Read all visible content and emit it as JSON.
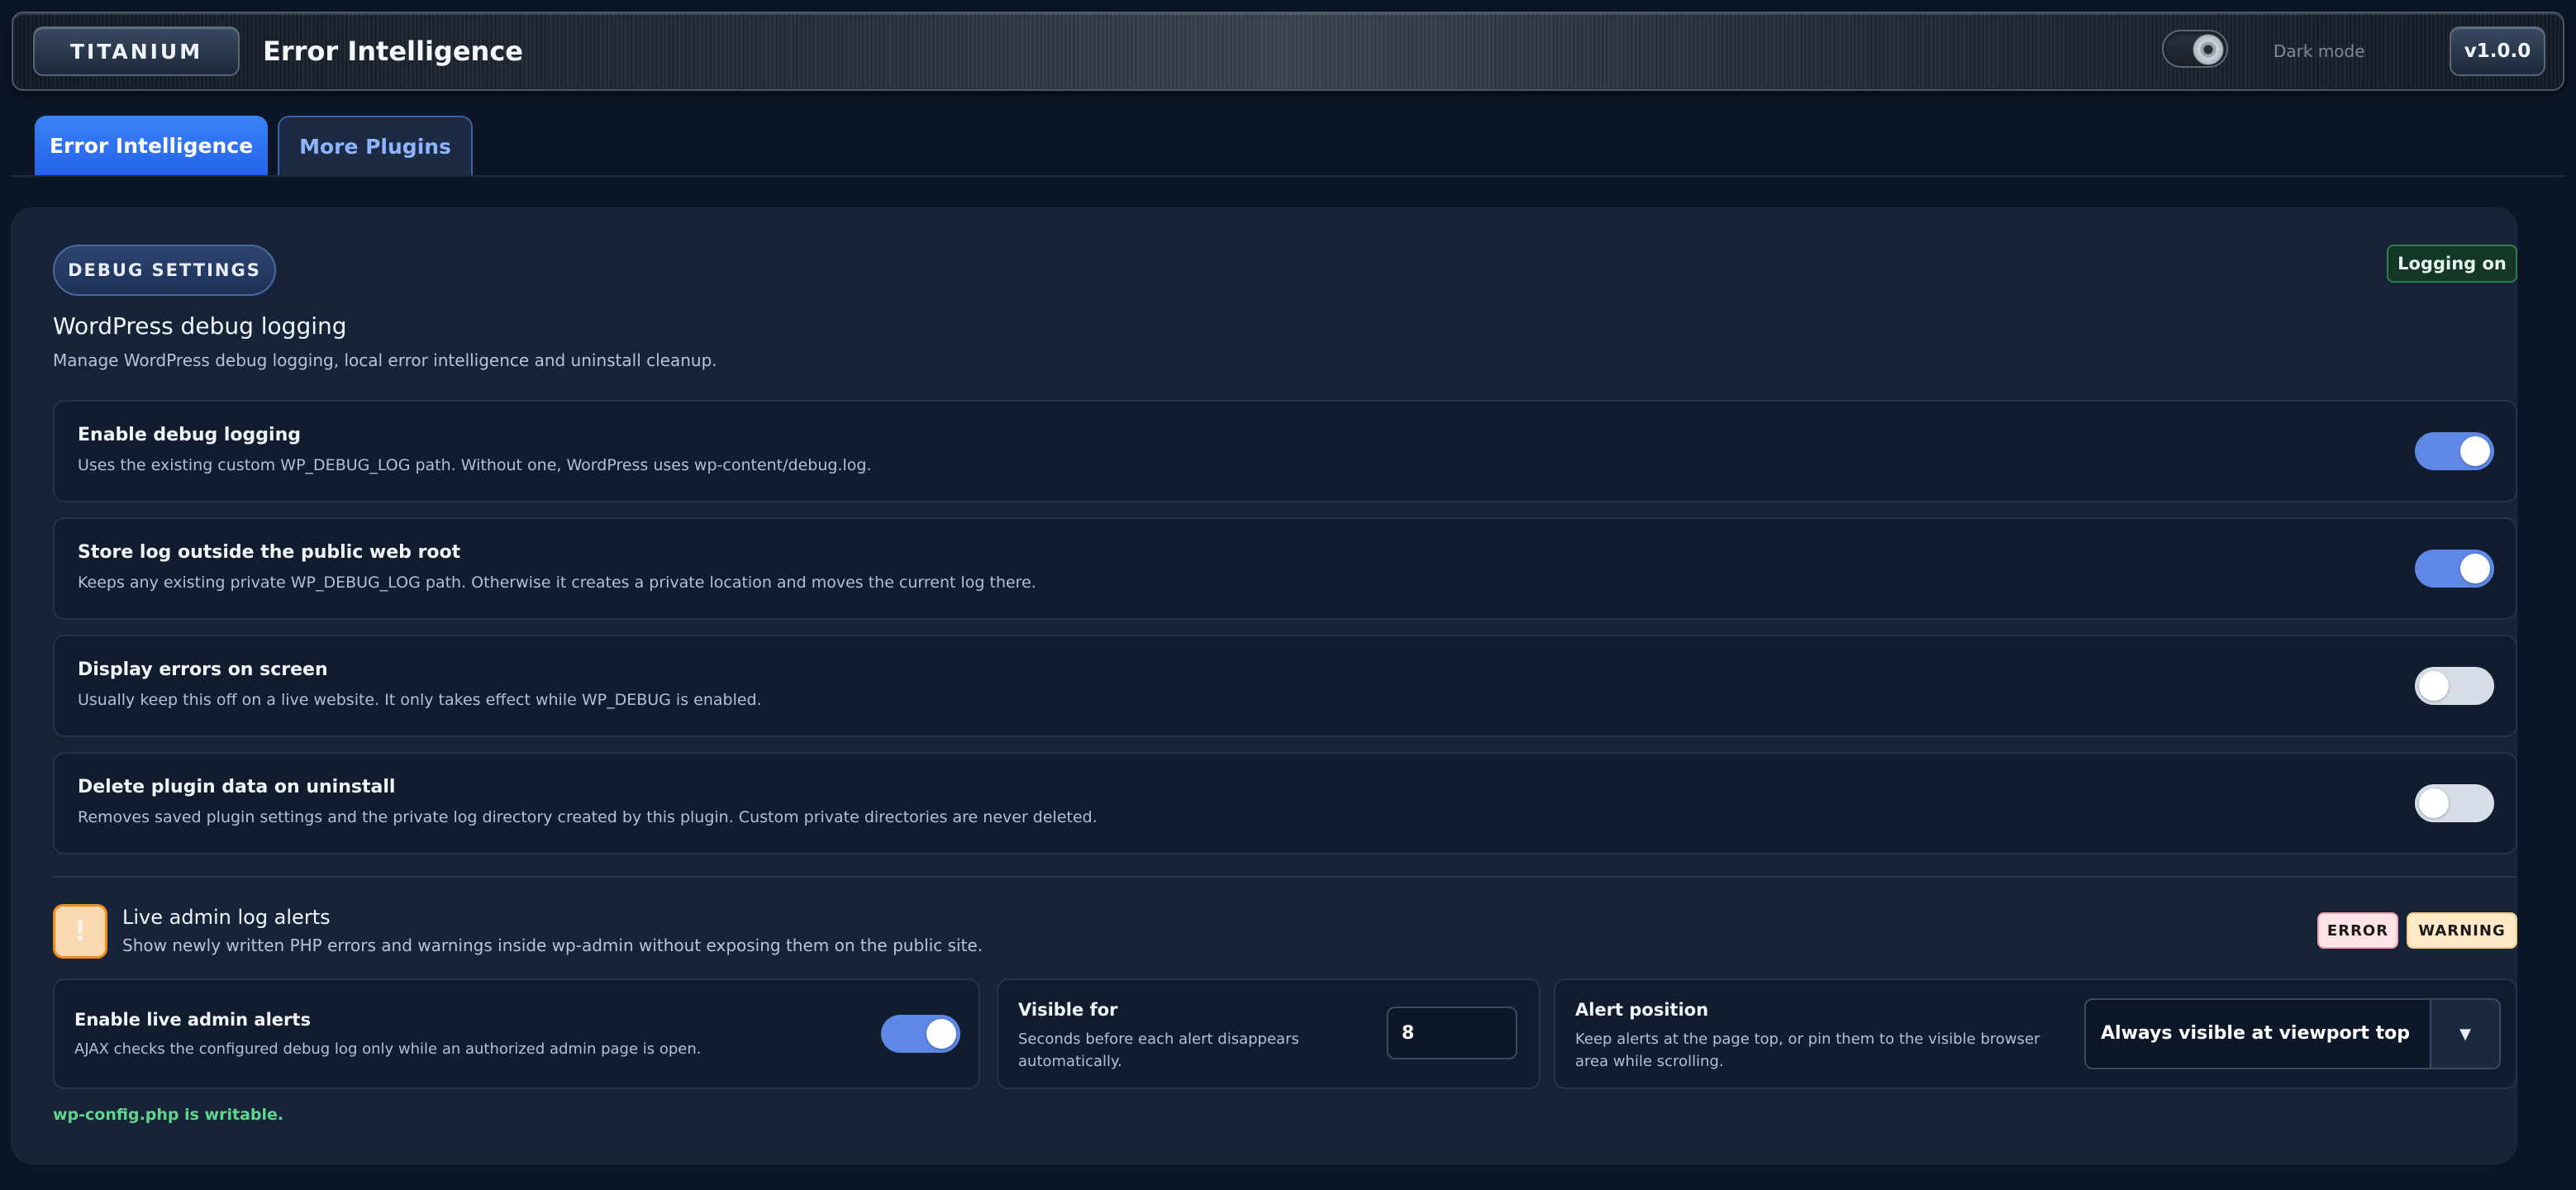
{
  "header": {
    "brand": "TITANIUM",
    "title": "Error Intelligence",
    "dark_mode_label": "Dark mode",
    "version": "v1.0.0"
  },
  "tabs": [
    {
      "label": "Error Intelligence",
      "active": true
    },
    {
      "label": "More Plugins",
      "active": false
    }
  ],
  "panel": {
    "section_label": "DEBUG SETTINGS",
    "status_badge": "Logging on",
    "title": "WordPress debug logging",
    "description": "Manage WordPress debug logging, local error intelligence and uninstall cleanup."
  },
  "settings": [
    {
      "title": "Enable debug logging",
      "description": "Uses the existing custom WP_DEBUG_LOG path. Without one, WordPress uses wp-content/debug.log.",
      "enabled": true
    },
    {
      "title": "Store log outside the public web root",
      "description": "Keeps any existing private WP_DEBUG_LOG path. Otherwise it creates a private location and moves the current log there.",
      "enabled": true
    },
    {
      "title": "Display errors on screen",
      "description": "Usually keep this off on a live website. It only takes effect while WP_DEBUG is enabled.",
      "enabled": false
    },
    {
      "title": "Delete plugin data on uninstall",
      "description": "Removes saved plugin settings and the private log directory created by this plugin. Custom private directories are never deleted.",
      "enabled": false
    }
  ],
  "alerts": {
    "icon_glyph": "!",
    "title": "Live admin log alerts",
    "description": "Show newly written PHP errors and warnings inside wp-admin without exposing them on the public site.",
    "tags": [
      "ERROR",
      "WARNING"
    ],
    "live": {
      "title": "Enable live admin alerts",
      "description": "AJAX checks the configured debug log only while an authorized admin page is open.",
      "enabled": true
    },
    "visible_for": {
      "title": "Visible for",
      "description": "Seconds before each alert disappears automatically.",
      "value": "8"
    },
    "position": {
      "title": "Alert position",
      "description": "Keep alerts at the page top, or pin them to the visible browser area while scrolling.",
      "selected": "Always visible at viewport top",
      "arrow": "▼"
    }
  },
  "footer_note": "wp-config.php is writable.",
  "colors": {
    "accent": "#3b82f6",
    "toggle_on": "#5e88e6",
    "success": "#5fd58b",
    "warning": "#f08a1c"
  }
}
